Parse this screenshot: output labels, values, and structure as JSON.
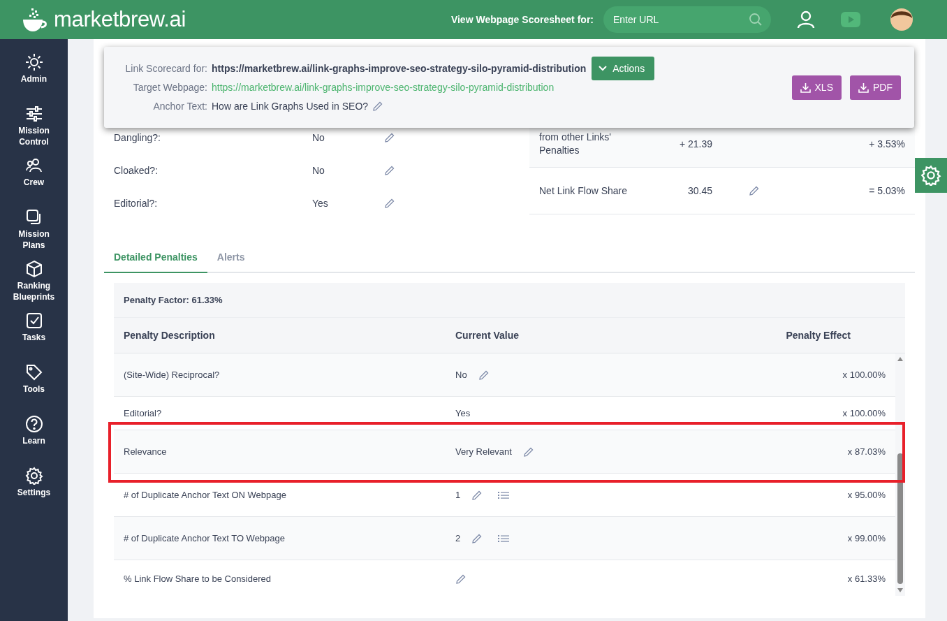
{
  "header": {
    "logo": "marketbrew.ai",
    "scoresheet_label": "View Webpage Scoresheet for:",
    "url_field": {
      "placeholder": "Enter URL"
    }
  },
  "sidebar": {
    "items": [
      {
        "label": "Admin"
      },
      {
        "label": "Mission Control"
      },
      {
        "label": "Crew"
      },
      {
        "label": "Mission Plans"
      },
      {
        "label": "Ranking Blueprints"
      },
      {
        "label": "Tasks"
      },
      {
        "label": "Tools"
      },
      {
        "label": "Learn"
      },
      {
        "label": "Settings"
      }
    ]
  },
  "scorecard": {
    "link_label": "Link Scorecard for:",
    "link_url": "https://marketbrew.ai/link-graphs-improve-seo-strategy-silo-pyramid-distribution",
    "actions_button": "Actions",
    "target_label": "Target Webpage:",
    "target_url": "https://marketbrew.ai/link-graphs-improve-seo-strategy-silo-pyramid-distribution",
    "anchor_label": "Anchor Text:",
    "anchor_text": "How are Link Graphs Used in SEO?",
    "buttons": [
      "XLS",
      "PDF"
    ]
  },
  "link_properties": [
    {
      "label": "Dangling?:",
      "value": "No"
    },
    {
      "label": "Cloaked?:",
      "value": "No"
    },
    {
      "label": "Editorial?:",
      "value": "Yes"
    }
  ],
  "link_flow": [
    {
      "label": "from other Links' Penalties",
      "value": "+ 21.39",
      "editable": false,
      "effect": "+ 3.53%"
    },
    {
      "label": "Net Link Flow Share",
      "value": "30.45",
      "editable": true,
      "effect": "= 5.03%"
    }
  ],
  "tabs": [
    {
      "label": "Detailed Penalties",
      "selected": true
    },
    {
      "label": "Alerts",
      "selected": false
    }
  ],
  "penalties": {
    "factor": "Penalty Factor: 61.33%",
    "columns": [
      "Penalty Description",
      "Current Value",
      "Penalty Effect"
    ],
    "rows": [
      {
        "description": "(Site-Wide) Reciprocal?",
        "value": "No",
        "editable": true,
        "list": false,
        "effect": "x 100.00%",
        "highlighted": false
      },
      {
        "description": "Editorial?",
        "value": "Yes",
        "editable": false,
        "list": false,
        "effect": "x 100.00%",
        "highlighted": false
      },
      {
        "description": "Relevance",
        "value": "Very Relevant",
        "editable": true,
        "list": false,
        "effect": "x 87.03%",
        "highlighted": true
      },
      {
        "description": "# of Duplicate Anchor Text ON Webpage",
        "value": "1",
        "editable": true,
        "list": true,
        "effect": "x 95.00%",
        "highlighted": false
      },
      {
        "description": "# of Duplicate Anchor Text TO Webpage",
        "value": "2",
        "editable": true,
        "list": true,
        "effect": "x 99.00%",
        "highlighted": false
      },
      {
        "description": "% Link Flow Share to be Considered",
        "editable": true,
        "list": false,
        "effect": "x 61.33%",
        "highlighted": false
      }
    ]
  }
}
